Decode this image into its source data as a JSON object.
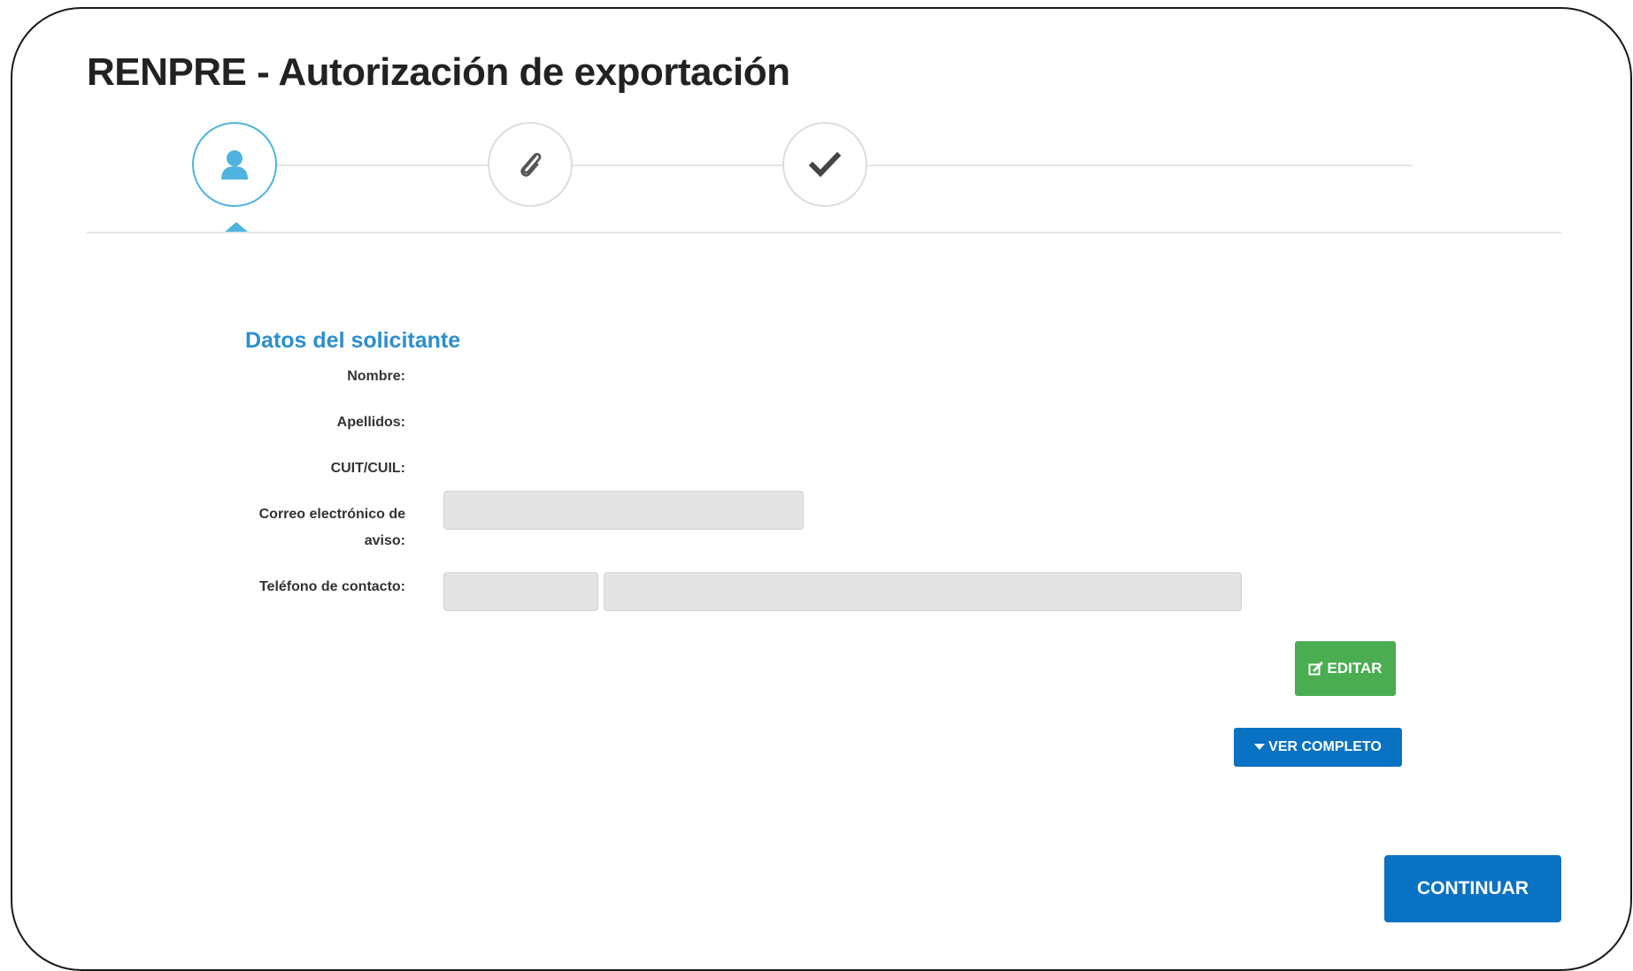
{
  "page": {
    "title": "RENPRE - Autorización de exportación"
  },
  "stepper": {
    "steps": [
      {
        "icon": "user-icon",
        "active": true
      },
      {
        "icon": "paperclip-icon",
        "active": false
      },
      {
        "icon": "checkmark-icon",
        "active": false
      }
    ],
    "colors": {
      "active": "#4fb3df",
      "inactive": "#dddddd",
      "icon_active": "#4fb3df",
      "icon_inactive": "#555555"
    }
  },
  "section": {
    "title": "Datos del solicitante"
  },
  "form": {
    "nombre_label": "Nombre:",
    "apellidos_label": "Apellidos:",
    "cuit_label": "CUIT/CUIL:",
    "correo_label_line1": "Correo electrónico de",
    "correo_label_line2": "aviso:",
    "correo_value": "",
    "telefono_label": "Teléfono de contacto:",
    "telefono_area_value": "",
    "telefono_number_value": ""
  },
  "buttons": {
    "editar_label": "EDITAR",
    "editar_icon": "edit-icon",
    "ver_completo_label": "VER COMPLETO",
    "ver_completo_icon": "caret-down-icon",
    "continuar_label": "CONTINUAR"
  },
  "colors": {
    "title": "#222222",
    "section_title": "#2a8fd0",
    "edit_button": "#4aad52",
    "primary_button": "#0a72c2",
    "input_bg": "#e4e4e4"
  }
}
